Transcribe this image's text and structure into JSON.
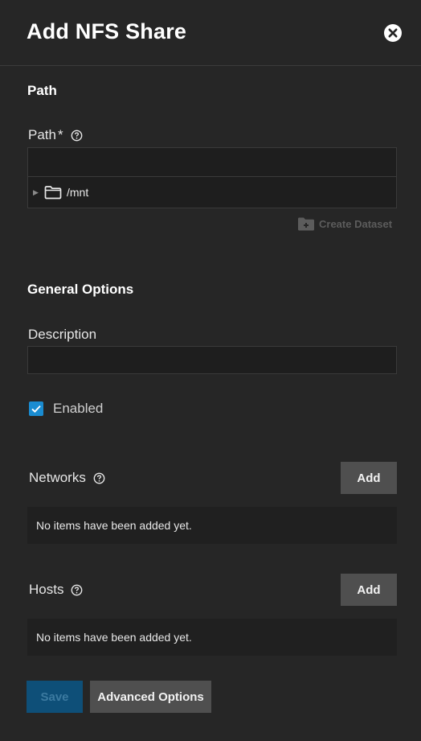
{
  "header": {
    "title": "Add NFS Share",
    "close_icon": "close-circle-icon"
  },
  "path_section": {
    "title": "Path",
    "field_label": "Path",
    "required_mark": "*",
    "input_value": "",
    "tree": [
      {
        "label": "/mnt",
        "icon": "folder-icon",
        "expanded": false
      }
    ],
    "create_dataset_label": "Create Dataset"
  },
  "general_section": {
    "title": "General Options",
    "description_label": "Description",
    "description_value": "",
    "enabled_label": "Enabled",
    "enabled_checked": true
  },
  "networks": {
    "label": "Networks",
    "add_label": "Add",
    "empty_text": "No items have been added yet."
  },
  "hosts": {
    "label": "Hosts",
    "add_label": "Add",
    "empty_text": "No items have been added yet."
  },
  "footer": {
    "save_label": "Save",
    "save_enabled": false,
    "advanced_label": "Advanced Options"
  },
  "colors": {
    "background": "#262626",
    "accent": "#1a8cd1",
    "button": "#4f4f4f",
    "save_disabled": "#0e4f78"
  }
}
